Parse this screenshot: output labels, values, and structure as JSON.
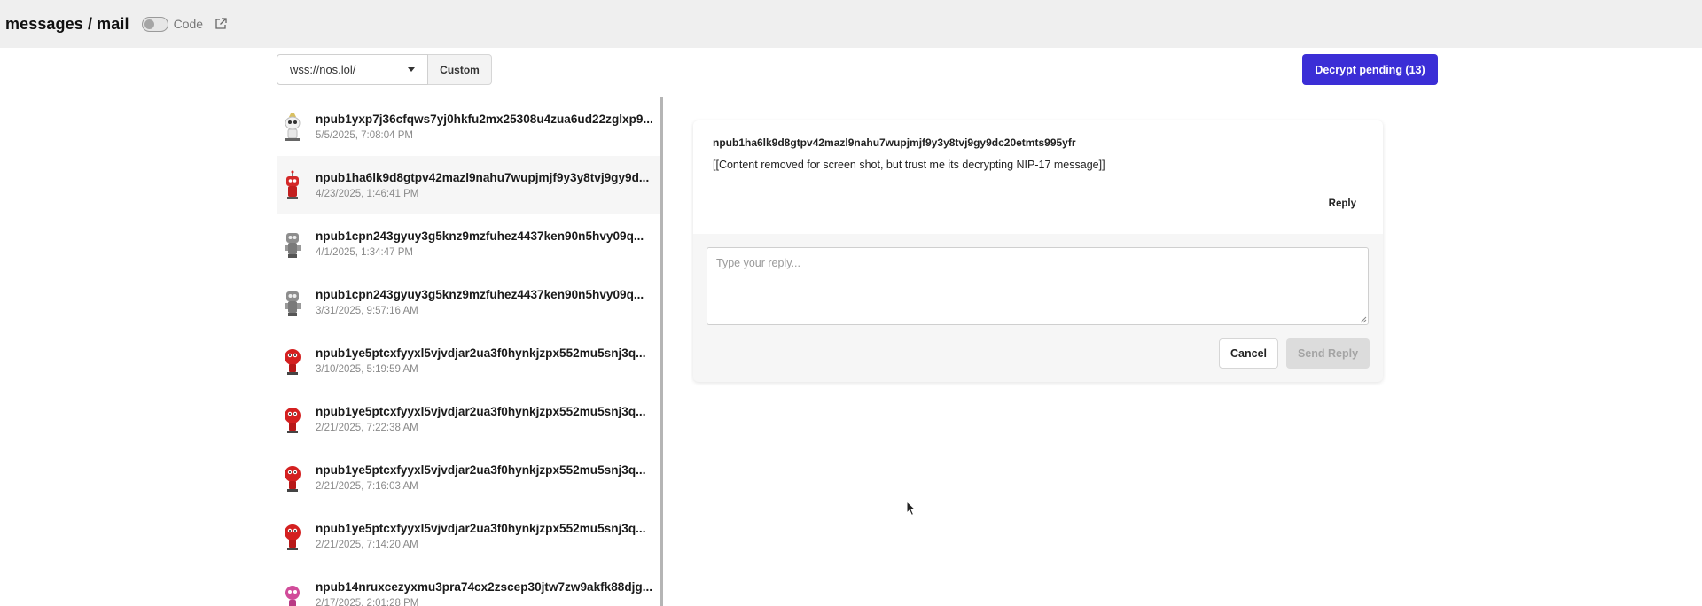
{
  "header": {
    "title": "messages / mail",
    "toggle_label": "Code",
    "toggle_on": false,
    "external_link_icon": "external-link-icon"
  },
  "toolbar": {
    "relay_selected": "wss://nos.lol/",
    "custom_label": "Custom",
    "decrypt_label": "Decrypt pending (13)",
    "decrypt_color": "#3b2ed6"
  },
  "messages": [
    {
      "npub": "npub1yxp7j36cfqws7yj0hkfu2mx25308u4zua6ud22zglxp9...",
      "date": "5/5/2025, 7:08:04 PM",
      "avatar": "robot-white-avatar"
    },
    {
      "npub": "npub1ha6lk9d8gtpv42mazl9nahu7wupjmjf9y3y8tvj9gy9d...",
      "date": "4/23/2025, 1:46:41 PM",
      "avatar": "robot-red-antenna-avatar"
    },
    {
      "npub": "npub1cpn243gyuy3g5knz9mzfuhez4437ken90n5hvy09q...",
      "date": "4/1/2025, 1:34:47 PM",
      "avatar": "robot-grey-avatar"
    },
    {
      "npub": "npub1cpn243gyuy3g5knz9mzfuhez4437ken90n5hvy09q...",
      "date": "3/31/2025, 9:57:16 AM",
      "avatar": "robot-grey-avatar"
    },
    {
      "npub": "npub1ye5ptcxfyyxl5vjvdjar2ua3f0hynkjzpx552mu5snj3q...",
      "date": "3/10/2025, 5:19:59 AM",
      "avatar": "robot-red-round-avatar"
    },
    {
      "npub": "npub1ye5ptcxfyyxl5vjvdjar2ua3f0hynkjzpx552mu5snj3q...",
      "date": "2/21/2025, 7:22:38 AM",
      "avatar": "robot-red-round-avatar"
    },
    {
      "npub": "npub1ye5ptcxfyyxl5vjvdjar2ua3f0hynkjzpx552mu5snj3q...",
      "date": "2/21/2025, 7:16:03 AM",
      "avatar": "robot-red-round-avatar"
    },
    {
      "npub": "npub1ye5ptcxfyyxl5vjvdjar2ua3f0hynkjzpx552mu5snj3q...",
      "date": "2/21/2025, 7:14:20 AM",
      "avatar": "robot-red-round-avatar"
    },
    {
      "npub": "npub14nruxcezyxmu3pra74cx2zscep30jtw7zw9akfk88djg...",
      "date": "2/17/2025, 2:01:28 PM",
      "avatar": "robot-pink-avatar"
    }
  ],
  "selected_index": 1,
  "detail": {
    "sender": "npub1ha6lk9d8gtpv42mazl9nahu7wupjmjf9y3y8tvj9gy9dc20etmts995yfr",
    "content": "[[Content removed for screen shot, but trust me its decrypting NIP-17 message]]",
    "reply_label": "Reply",
    "reply_placeholder": "Type your reply...",
    "cancel_label": "Cancel",
    "send_label": "Send Reply"
  }
}
